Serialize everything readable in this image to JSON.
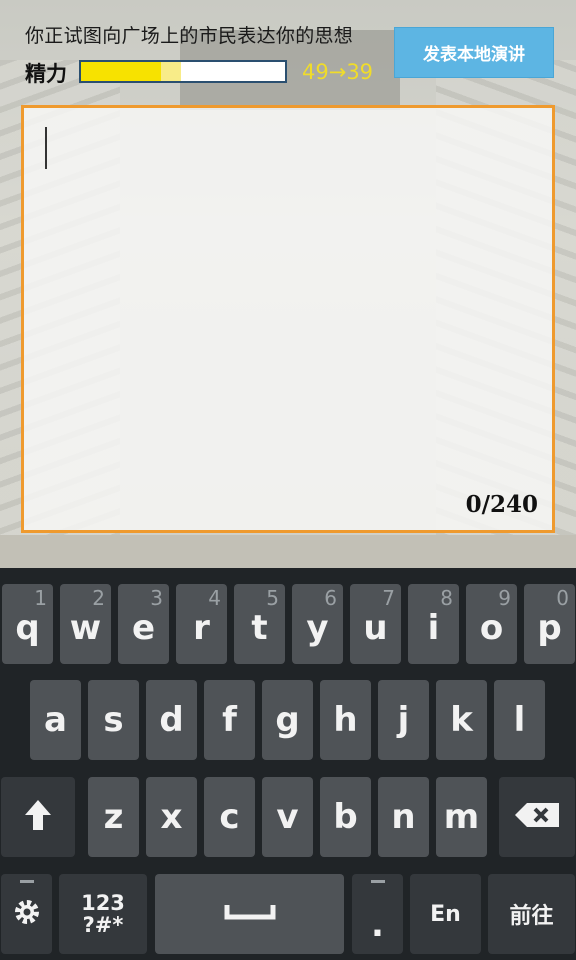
{
  "prompt": "你正试图向广场上的市民表达你的思想",
  "stamina": {
    "label": "精力",
    "current": 49,
    "after": 39,
    "max": 100,
    "text": "49→39"
  },
  "speak_button": "发表本地演讲",
  "editor": {
    "value": "",
    "counter": "0/240"
  },
  "keyboard": {
    "row1": [
      {
        "k": "q",
        "h": "1"
      },
      {
        "k": "w",
        "h": "2"
      },
      {
        "k": "e",
        "h": "3"
      },
      {
        "k": "r",
        "h": "4"
      },
      {
        "k": "t",
        "h": "5"
      },
      {
        "k": "y",
        "h": "6"
      },
      {
        "k": "u",
        "h": "7"
      },
      {
        "k": "i",
        "h": "8"
      },
      {
        "k": "o",
        "h": "9"
      },
      {
        "k": "p",
        "h": "0"
      }
    ],
    "row2": [
      "a",
      "s",
      "d",
      "f",
      "g",
      "h",
      "j",
      "k",
      "l"
    ],
    "row3": [
      "z",
      "x",
      "c",
      "v",
      "b",
      "n",
      "m"
    ],
    "symbols_line1": "123",
    "symbols_line2": "?#*",
    "period": ".",
    "lang": "En",
    "go": "前往"
  },
  "icons": {
    "shift": "up-arrow-icon",
    "backspace": "backspace-icon",
    "settings": "gear-icon",
    "space": "space-bar-icon"
  }
}
